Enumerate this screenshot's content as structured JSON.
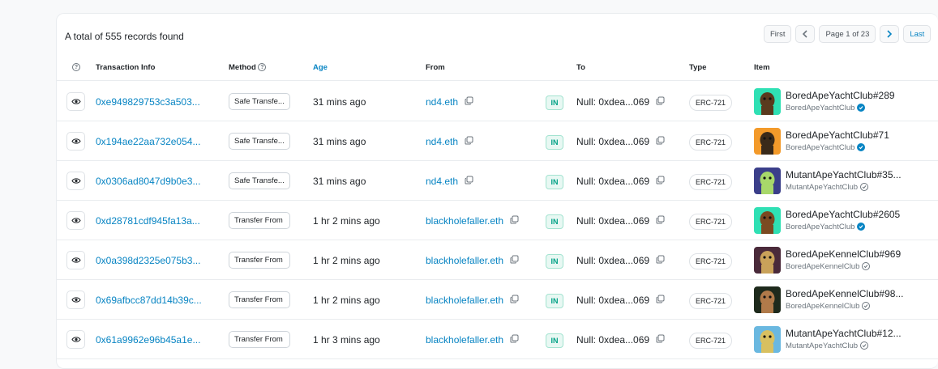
{
  "summary": "A total of 555 records found",
  "pagination": {
    "first": "First",
    "page": "Page 1 of 23",
    "last": "Last"
  },
  "headers": {
    "help": "?",
    "txn": "Transaction Info",
    "method": "Method",
    "age": "Age",
    "from": "From",
    "to": "To",
    "type": "Type",
    "item": "Item"
  },
  "colors": {
    "accent": "#0784c3",
    "in_badge": "#00a186"
  },
  "rows": [
    {
      "txn": "0xe949829753c3a503...",
      "method": "Safe Transfe...",
      "age": "31 mins ago",
      "from": "nd4.eth",
      "dir": "IN",
      "to": "Null: 0xdea...069",
      "type": "ERC-721",
      "item": "BoredApeYachtClub#289",
      "collection": "BoredApeYachtClub",
      "verified": true,
      "thumb_bg": "#2fe0b4",
      "thumb_fg": "#5a3a1e"
    },
    {
      "txn": "0x194ae22aa732e054...",
      "method": "Safe Transfe...",
      "age": "31 mins ago",
      "from": "nd4.eth",
      "dir": "IN",
      "to": "Null: 0xdea...069",
      "type": "ERC-721",
      "item": "BoredApeYachtClub#71",
      "collection": "BoredApeYachtClub",
      "verified": true,
      "thumb_bg": "#f39a2a",
      "thumb_fg": "#3a2a1a"
    },
    {
      "txn": "0x0306ad8047d9b0e3...",
      "method": "Safe Transfe...",
      "age": "31 mins ago",
      "from": "nd4.eth",
      "dir": "IN",
      "to": "Null: 0xdea...069",
      "type": "ERC-721",
      "item": "MutantApeYachtClub#35...",
      "collection": "MutantApeYachtClub",
      "verified": false,
      "thumb_bg": "#3b3f8a",
      "thumb_fg": "#a8d86a"
    },
    {
      "txn": "0xd28781cdf945fa13a...",
      "method": "Transfer From",
      "age": "1 hr 2 mins ago",
      "from": "blackholefaller.eth",
      "dir": "IN",
      "to": "Null: 0xdea...069",
      "type": "ERC-721",
      "item": "BoredApeYachtClub#2605",
      "collection": "BoredApeYachtClub",
      "verified": true,
      "thumb_bg": "#2fe0b4",
      "thumb_fg": "#7b4a22"
    },
    {
      "txn": "0x0a398d2325e075b3...",
      "method": "Transfer From",
      "age": "1 hr 2 mins ago",
      "from": "blackholefaller.eth",
      "dir": "IN",
      "to": "Null: 0xdea...069",
      "type": "ERC-721",
      "item": "BoredApeKennelClub#969",
      "collection": "BoredApeKennelClub",
      "verified": false,
      "thumb_bg": "#4a2a3a",
      "thumb_fg": "#c9a25a"
    },
    {
      "txn": "0x69afbcc87dd14b39c...",
      "method": "Transfer From",
      "age": "1 hr 2 mins ago",
      "from": "blackholefaller.eth",
      "dir": "IN",
      "to": "Null: 0xdea...069",
      "type": "ERC-721",
      "item": "BoredApeKennelClub#98...",
      "collection": "BoredApeKennelClub",
      "verified": false,
      "thumb_bg": "#1e2a1c",
      "thumb_fg": "#b07a4a"
    },
    {
      "txn": "0x61a9962e96b45a1e...",
      "method": "Transfer From",
      "age": "1 hr 3 mins ago",
      "from": "blackholefaller.eth",
      "dir": "IN",
      "to": "Null: 0xdea...069",
      "type": "ERC-721",
      "item": "MutantApeYachtClub#12...",
      "collection": "MutantApeYachtClub",
      "verified": false,
      "thumb_bg": "#6ab8e0",
      "thumb_fg": "#d8c060"
    }
  ]
}
